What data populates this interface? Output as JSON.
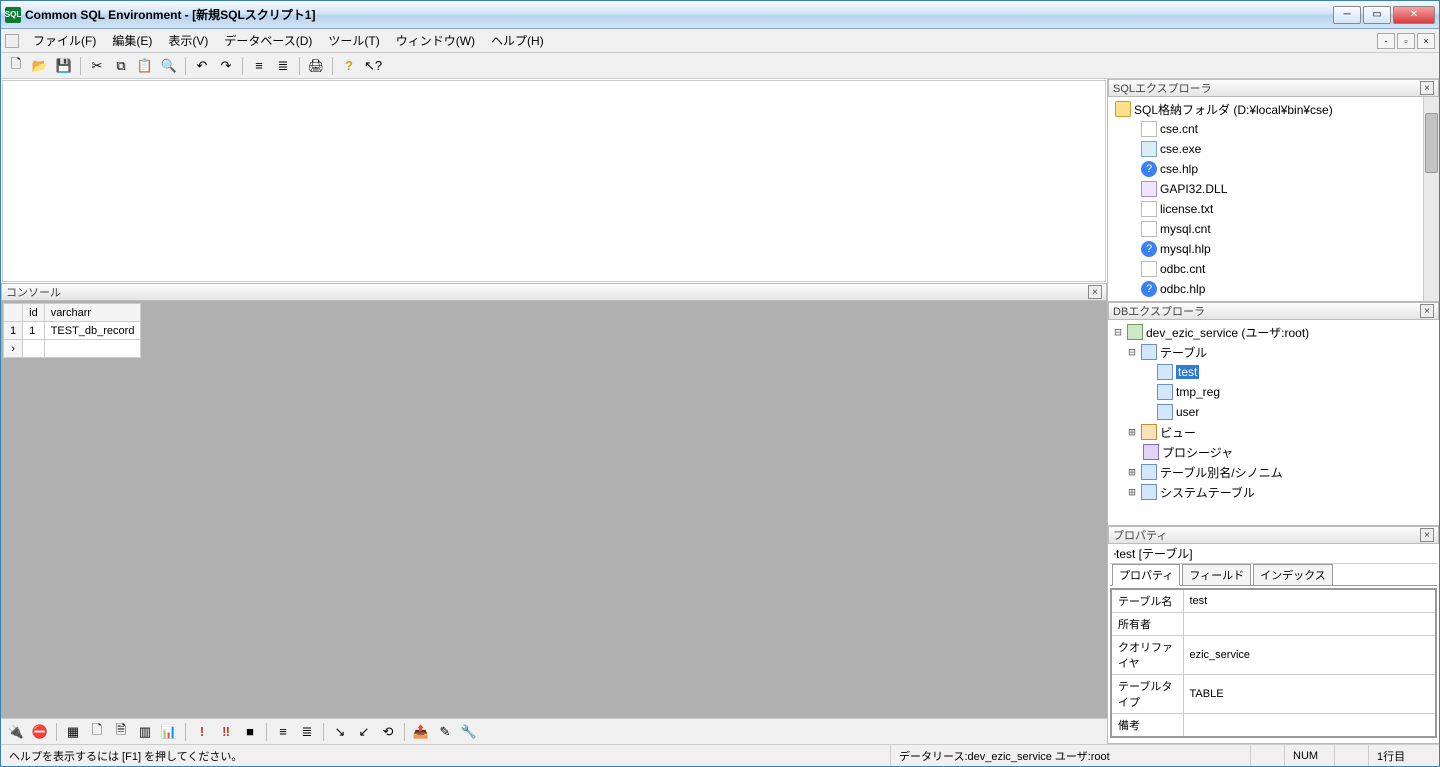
{
  "title": "Common SQL Environment - [新規SQLスクリプト1]",
  "menus": {
    "file": "ファイル(F)",
    "edit": "編集(E)",
    "view": "表示(V)",
    "database": "データベース(D)",
    "tool": "ツール(T)",
    "window": "ウィンドウ(W)",
    "help": "ヘルプ(H)"
  },
  "console": {
    "title": "コンソール"
  },
  "result": {
    "columns": [
      "id",
      "varcharr"
    ],
    "rows": [
      {
        "n": "1",
        "c0": "1",
        "c1": "TEST_db_record"
      }
    ]
  },
  "sql_explorer": {
    "title": "SQLエクスプローラ",
    "root": "SQL格納フォルダ (D:¥local¥bin¥cse)",
    "files": [
      "cse.cnt",
      "cse.exe",
      "cse.hlp",
      "GAPI32.DLL",
      "license.txt",
      "mysql.cnt",
      "mysql.hlp",
      "odbc.cnt",
      "odbc.hlp"
    ]
  },
  "db_explorer": {
    "title": "DBエクスプローラ",
    "db": "dev_ezic_service (ユーザ:root)",
    "tables_label": "テーブル",
    "tables": [
      "test",
      "tmp_reg",
      "user"
    ],
    "views_label": "ビュー",
    "procs_label": "プロシージャ",
    "aliases_label": "テーブル別名/シノニム",
    "systables_label": "システムテーブル"
  },
  "properties": {
    "panel_title": "プロパティ",
    "object": "test [テーブル]",
    "tabs": {
      "prop": "プロパティ",
      "field": "フィールド",
      "index": "インデックス"
    },
    "rows": {
      "table_name_label": "テーブル名",
      "table_name": "test",
      "owner_label": "所有者",
      "owner": "",
      "qualifier_label": "クオリファイヤ",
      "qualifier": "ezic_service",
      "type_label": "テーブルタイプ",
      "type": "TABLE",
      "remarks_label": "備考",
      "remarks": ""
    }
  },
  "status": {
    "help": "ヘルプを表示するには [F1] を押してください。",
    "datasource": "データリース:dev_ezic_service ユーザ:root",
    "num": "NUM",
    "line": "1行目"
  }
}
